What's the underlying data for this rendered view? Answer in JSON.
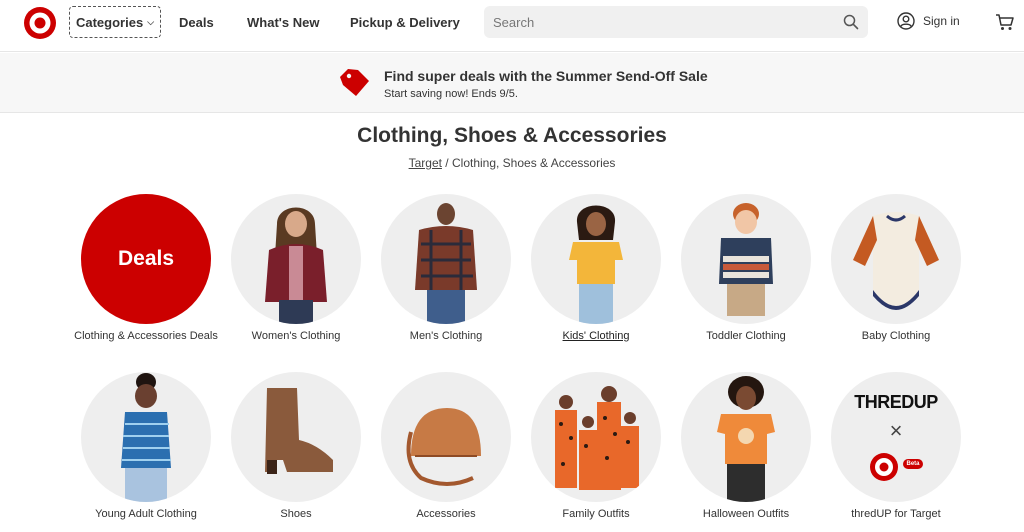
{
  "header": {
    "categories_label": "Categories",
    "nav": [
      "Deals",
      "What's New",
      "Pickup & Delivery"
    ],
    "search_placeholder": "Search",
    "signin_label": "Sign in",
    "brand_color": "#cc0000"
  },
  "promo": {
    "title": "Find super deals with the Summer Send-Off Sale",
    "subtitle": "Start saving now! Ends 9/5."
  },
  "page": {
    "title": "Clothing, Shoes & Accessories",
    "breadcrumb_root": "Target",
    "breadcrumb_sep": "/",
    "breadcrumb_current": "Clothing, Shoes & Accessories"
  },
  "tiles": [
    {
      "label": "Clothing & Accessories Deals",
      "circle_text": "Deals"
    },
    {
      "label": "Women's Clothing"
    },
    {
      "label": "Men's Clothing"
    },
    {
      "label": "Kids' Clothing"
    },
    {
      "label": "Toddler Clothing"
    },
    {
      "label": "Baby Clothing"
    },
    {
      "label": "Young Adult Clothing"
    },
    {
      "label": "Shoes"
    },
    {
      "label": "Accessories"
    },
    {
      "label": "Family Outfits"
    },
    {
      "label": "Halloween Outfits"
    },
    {
      "label": "thredUP for Target",
      "brand_text": "THREDUP",
      "badge_text": "Beta",
      "times_glyph": "×"
    }
  ]
}
